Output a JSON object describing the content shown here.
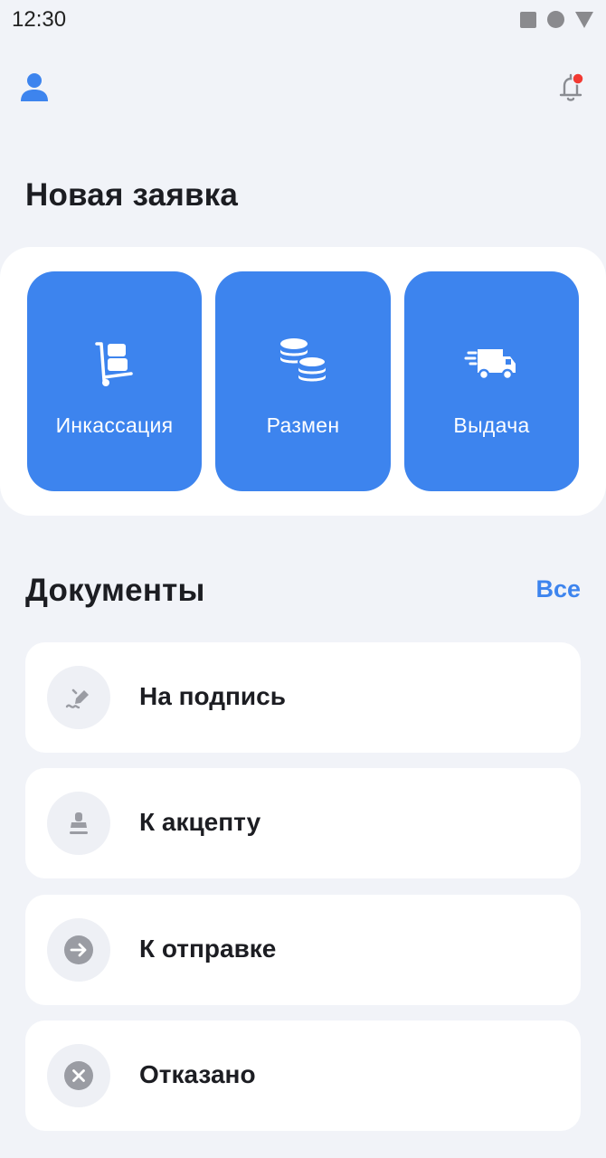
{
  "status_bar": {
    "time": "12:30"
  },
  "header": {
    "profile_icon": "user-icon",
    "bell_icon": "bell-icon",
    "notification_dot_color": "#f23a33"
  },
  "new_request": {
    "title": "Новая заявка",
    "tiles": [
      {
        "label": "Инкассация",
        "icon": "cart-icon"
      },
      {
        "label": "Размен",
        "icon": "coins-icon"
      },
      {
        "label": "Выдача",
        "icon": "truck-icon"
      }
    ]
  },
  "documents": {
    "title": "Документы",
    "all_label": "Все",
    "items": [
      {
        "label": "На подпись",
        "icon": "signature-icon"
      },
      {
        "label": "К акцепту",
        "icon": "stamp-icon"
      },
      {
        "label": "К отправке",
        "icon": "arrow-right-icon"
      },
      {
        "label": "Отказано",
        "icon": "close-icon"
      }
    ]
  },
  "colors": {
    "accent": "#3d84ee",
    "background": "#f1f3f8",
    "card": "#ffffff",
    "icon_gray": "#9a9ca3"
  }
}
